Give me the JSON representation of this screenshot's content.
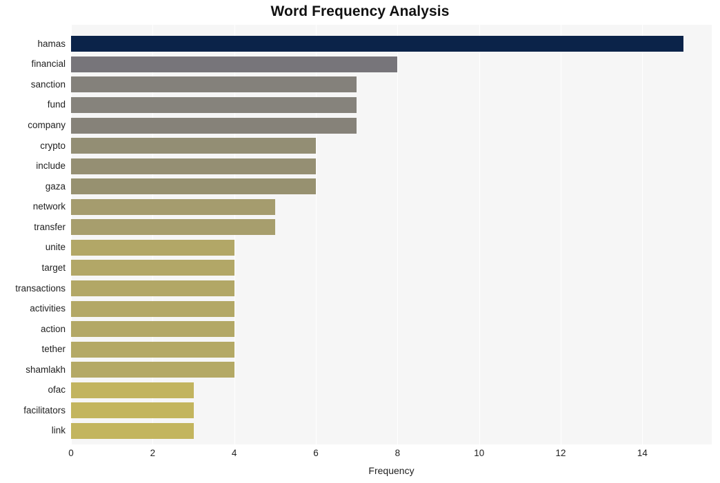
{
  "chart_data": {
    "type": "bar",
    "orientation": "horizontal",
    "title": "Word Frequency Analysis",
    "xlabel": "Frequency",
    "ylabel": "",
    "categories": [
      "hamas",
      "financial",
      "sanction",
      "fund",
      "company",
      "crypto",
      "include",
      "gaza",
      "network",
      "transfer",
      "unite",
      "target",
      "transactions",
      "activities",
      "action",
      "tether",
      "shamlakh",
      "ofac",
      "facilitators",
      "link"
    ],
    "values": [
      15,
      8,
      7,
      7,
      7,
      6,
      6,
      6,
      5,
      5,
      4,
      4,
      4,
      4,
      4,
      4,
      4,
      3,
      3,
      3
    ],
    "bar_colors": [
      "#0b2349",
      "#77757a",
      "#84817b",
      "#86837c",
      "#868279",
      "#938e74",
      "#958f73",
      "#979170",
      "#a59c6e",
      "#a79e6d",
      "#b2a767",
      "#b2a767",
      "#b2a766",
      "#b3a866",
      "#b3a866",
      "#b4a965",
      "#b4a965",
      "#c2b45f",
      "#c3b55e",
      "#c3b55e"
    ],
    "xticks": [
      0,
      2,
      4,
      6,
      8,
      10,
      12,
      14
    ],
    "xtick_labels": [
      "0",
      "2",
      "4",
      "6",
      "8",
      "10",
      "12",
      "14"
    ],
    "xlim": [
      0,
      15.7
    ],
    "grid": "vertical-only",
    "legend": "none",
    "plot_background": "#f6f6f6",
    "gridline_color": "#ffffff",
    "figure_background": "#ffffff"
  }
}
